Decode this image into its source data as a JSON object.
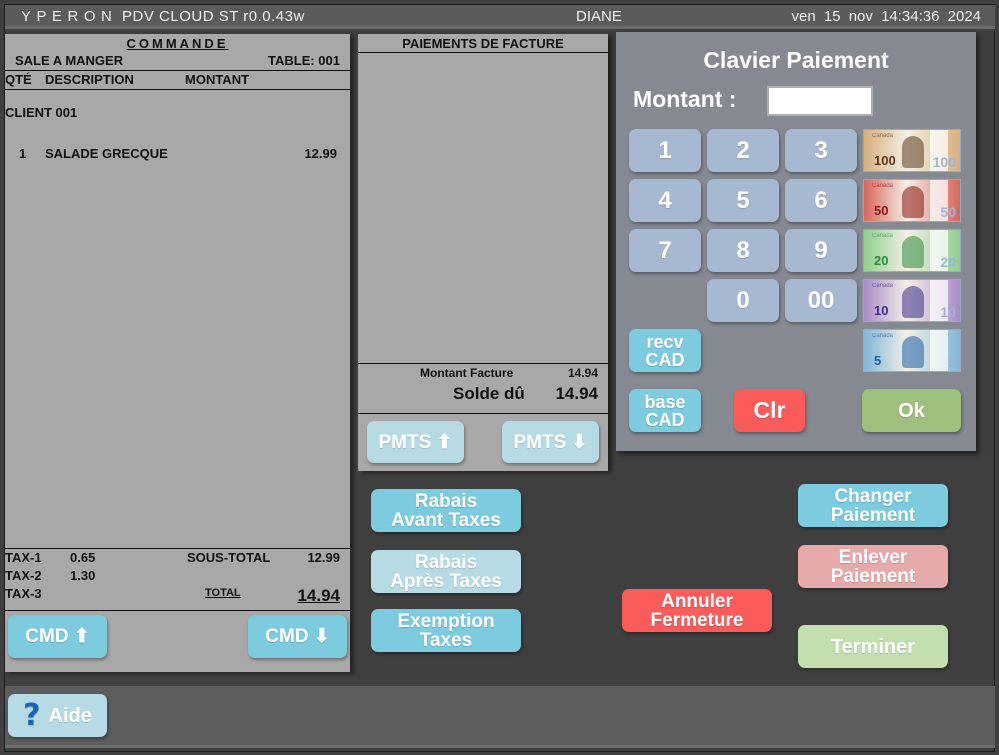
{
  "titlebar": {
    "brand": "YPERON",
    "app": "PDV  CLOUD ST r0.0.43w",
    "user": "DIANE",
    "datetime": "ven  15  nov  14:34:36  2024"
  },
  "commande": {
    "title": "COMMANDE",
    "sale": "SALE A MANGER",
    "table": "TABLE: 001",
    "columns": {
      "qte": "QTÉ",
      "description": "DESCRIPTION",
      "montant": "MONTANT"
    },
    "client": "CLIENT 001",
    "items": [
      {
        "qty": "1",
        "description": "SALADE GRECQUE",
        "price": "12.99"
      }
    ],
    "taxes": [
      {
        "label": "TAX-1",
        "value": "0.65"
      },
      {
        "label": "TAX-2",
        "value": "1.30"
      },
      {
        "label": "TAX-3",
        "value": ""
      }
    ],
    "sous_total_label": "SOUS-TOTAL",
    "sous_total": "12.99",
    "total_label": "TOTAL",
    "total": "14.94",
    "btn_up": "CMD ⬆",
    "btn_down": "CMD ⬇"
  },
  "paiements": {
    "title": "PAIEMENTS DE FACTURE",
    "montant_facture_label": "Montant Facture",
    "montant_facture": "14.94",
    "solde_label": "Solde dû",
    "solde": "14.94",
    "btn_up": "PMTS ⬆",
    "btn_down": "PMTS ⬇"
  },
  "clavier": {
    "title": "Clavier Paiement",
    "montant_label": "Montant :",
    "montant_value": "",
    "keys": [
      "1",
      "2",
      "3",
      "4",
      "5",
      "6",
      "7",
      "8",
      "9",
      "0",
      "00"
    ],
    "recv": [
      "recv",
      "CAD"
    ],
    "base": [
      "base",
      "CAD"
    ],
    "clr": "Clr",
    "ok": "Ok",
    "bills": [
      {
        "value": "100",
        "color": "#d9b07c",
        "ink": "#5a3a1c"
      },
      {
        "value": "50",
        "color": "#d9655a",
        "ink": "#8a1010"
      },
      {
        "value": "20",
        "color": "#8fcf8c",
        "ink": "#2d8a3a"
      },
      {
        "value": "10",
        "color": "#a98bc9",
        "ink": "#3d2a86"
      },
      {
        "value": "5",
        "color": "#7fb8d8",
        "ink": "#1b5fa8"
      }
    ]
  },
  "actions": {
    "rabais_avant": [
      "Rabais",
      "Avant Taxes"
    ],
    "rabais_apres": [
      "Rabais",
      "Après Taxes"
    ],
    "exemption": [
      "Exemption",
      "Taxes"
    ],
    "annuler": [
      "Annuler",
      "Fermeture"
    ],
    "changer": [
      "Changer",
      "Paiement"
    ],
    "enlever": [
      "Enlever",
      "Paiement"
    ],
    "terminer": "Terminer"
  },
  "footer": {
    "help": "Aide"
  }
}
